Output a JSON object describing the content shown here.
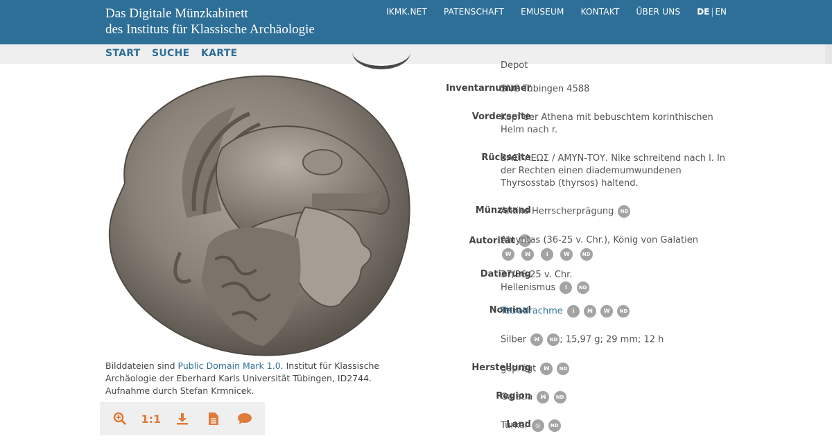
{
  "header": {
    "title_line1": "Das Digitale Münzkabinett",
    "title_line2": "des Instituts für Klassische Archäologie",
    "nav": [
      "IKMK.NET",
      "PATENSCHAFT",
      "EMUSEUM",
      "KONTAKT",
      "ÜBER UNS"
    ],
    "lang_de": "DE",
    "lang_sep": "|",
    "lang_en": "EN"
  },
  "subnav": [
    "START",
    "SUCHE",
    "KARTE"
  ],
  "caption": {
    "prefix": "Bilddateien sind ",
    "link": "Public Domain Mark 1.0",
    "suffix": ". Institut für Klassische Archäologie der Eberhard Karls Universität Tübingen, ID2744. Aufnahme durch Stefan Krmnicek."
  },
  "toolbar": {
    "zoom_icon": "zoom-in-icon",
    "actual_size_label": "1:1",
    "download_icon": "download-icon",
    "document_icon": "document-icon",
    "comment_icon": "comment-icon"
  },
  "details": {
    "depot": "Depot",
    "inventarnummer": {
      "label": "Inventarnummer",
      "value": "SNG Tübingen 4588"
    },
    "vorderseite": {
      "label": "Vorderseite",
      "value": "Kopf der Athena mit bebuschtem korinthischen Helm nach r."
    },
    "rueckseite": {
      "label": "Rückseite",
      "value": "ΒΑΣΙ-ΛΕΩΣ / ΑΜΥΝ-ΤΟΥ. Nike schreitend nach l. In der Rechten einen diademumwundenen Thyrsosstab (thyrsos) haltend."
    },
    "muenzstand": {
      "label": "Münzstand",
      "value": "Antike Herrscherprägung"
    },
    "autoritaet": {
      "label": "Autorität",
      "value": "Amyntas (36-25 v. Chr.), König von Galatien"
    },
    "datierung": {
      "label": "Datierung",
      "value1": "37/36-25 v. Chr.",
      "value2": "Hellenismus"
    },
    "nominal": {
      "label": "Nominal",
      "value": "Tetradrachme"
    },
    "material": {
      "prefix": "Silber",
      "suffix": "; 15,97 g; 29 mm; 12 h"
    },
    "herstellung": {
      "label": "Herstellung",
      "value": "geprägt"
    },
    "region": {
      "label": "Region",
      "value": "Galatia"
    },
    "land": {
      "label": "Land",
      "value": "Türkei"
    }
  },
  "badges": {
    "nd": "ND",
    "wiki": "W",
    "info": "i",
    "nomisma": "ꟽ",
    "globe": "◎"
  },
  "colors": {
    "header": "#2e6f98",
    "link": "#2e6f98",
    "tool": "#e07b3a",
    "badge": "#a3a3a3"
  }
}
